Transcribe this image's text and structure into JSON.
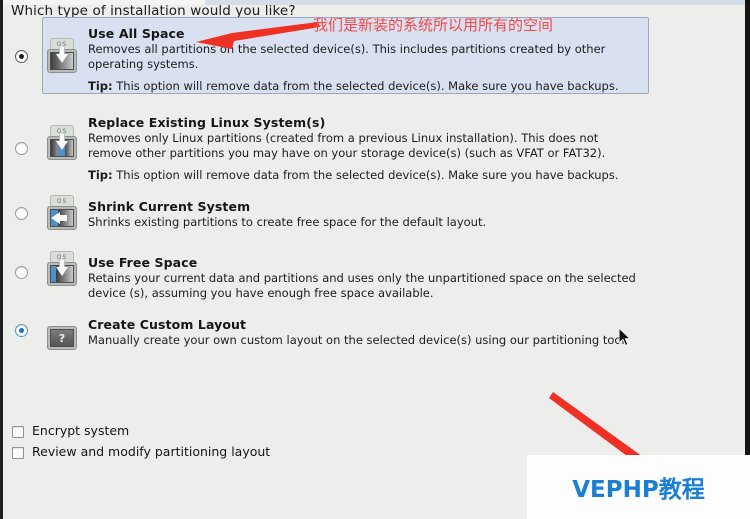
{
  "page": {
    "question": "Which type of installation would you like?"
  },
  "options": [
    {
      "id": "use-all-space",
      "title": "Use All Space",
      "desc": "Removes all partitions on the selected device(s).  This includes partitions created by other operating systems.",
      "tip_label": "Tip:",
      "tip": "This option will remove data from the selected device(s).  Make sure you have backups.",
      "icon": "os-disk-all-icon",
      "selected": true,
      "highlighted": true
    },
    {
      "id": "replace-existing-linux",
      "title": "Replace Existing Linux System(s)",
      "desc": "Removes only Linux partitions (created from a previous Linux installation).  This does not remove other partitions you may have on your storage device(s) (such as VFAT or FAT32).",
      "tip_label": "Tip:",
      "tip": "This option will remove data from the selected device(s).  Make sure you have backups.",
      "icon": "os-disk-replace-icon",
      "selected": false,
      "highlighted": false
    },
    {
      "id": "shrink-current-system",
      "title": "Shrink Current System",
      "desc": "Shrinks existing partitions to create free space for the default layout.",
      "tip_label": "",
      "tip": "",
      "icon": "os-disk-shrink-icon",
      "selected": false,
      "highlighted": false
    },
    {
      "id": "use-free-space",
      "title": "Use Free Space",
      "desc": "Retains your current data and partitions and uses only the unpartitioned space on the selected device (s), assuming you have enough free space available.",
      "tip_label": "",
      "tip": "",
      "icon": "os-disk-free-icon",
      "selected": false,
      "highlighted": false
    },
    {
      "id": "create-custom-layout",
      "title": "Create Custom Layout",
      "desc": "Manually create your own custom layout on the selected device(s) using our partitioning tool.",
      "tip_label": "",
      "tip": "",
      "icon": "question-mark-icon",
      "selected": false,
      "highlighted": false,
      "focused": true
    }
  ],
  "checkboxes": [
    {
      "id": "encrypt-system",
      "label": "Encrypt system",
      "checked": false
    },
    {
      "id": "review-modify-partitioning",
      "label": "Review and modify partitioning layout",
      "checked": false
    }
  ],
  "annotations": {
    "note_text": "我们是新装的系统所以用所有的空间",
    "note_color": "#f04b4b",
    "arrow_color": "#ee3124"
  },
  "watermark": {
    "text": "VEPHP教程",
    "color": "#1b7fd4",
    "background": "#fdfdfd"
  },
  "os_tag_label": "OS",
  "question_mark_glyph": "?"
}
